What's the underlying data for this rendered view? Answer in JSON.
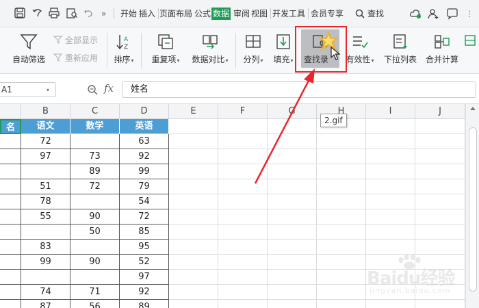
{
  "menubar": {
    "menus": [
      "开始",
      "插入",
      "页面布局",
      "公式",
      "数据",
      "审阅",
      "视图",
      "开发工具",
      "会员专享"
    ],
    "active_menu": "数据",
    "search_label": "查找",
    "more_glyph": "»"
  },
  "ribbon": {
    "autofilter": "自动筛选",
    "show_all": "全部显示",
    "reapply": "重新应用",
    "sort": "排序",
    "duplicates": "重复项",
    "compare": "数据对比",
    "split": "分列",
    "fill": "填充",
    "find_entry": "查找录",
    "validity": "有效性",
    "dropdown_list": "下拉列表",
    "consolidate": "合并计算"
  },
  "formulabar": {
    "namebox": "A1",
    "fx": "fx",
    "content": "姓名"
  },
  "grid": {
    "columns": [
      "B",
      "C",
      "D",
      "E",
      "F",
      "G",
      "H",
      "I",
      "J"
    ],
    "header_row": {
      "a": "名",
      "b": "语文",
      "c": "数学",
      "d": "英语"
    },
    "rows": [
      {
        "b": "72",
        "c": "",
        "d": "63"
      },
      {
        "b": "97",
        "c": "73",
        "d": "92"
      },
      {
        "b": "",
        "c": "89",
        "d": "99"
      },
      {
        "b": "51",
        "c": "72",
        "d": "79"
      },
      {
        "b": "78",
        "c": "",
        "d": "54"
      },
      {
        "b": "55",
        "c": "90",
        "d": "72"
      },
      {
        "b": "",
        "c": "50",
        "d": "85"
      },
      {
        "b": "83",
        "c": "",
        "d": "95"
      },
      {
        "b": "99",
        "c": "90",
        "d": "52"
      },
      {
        "b": "",
        "c": "",
        "d": "97"
      },
      {
        "b": "74",
        "c": "71",
        "d": "92"
      },
      {
        "b": "87",
        "c": "56",
        "d": "89"
      }
    ]
  },
  "tooltip": "2.gif",
  "watermark": {
    "brand": "Baidu经验",
    "url": "jingyan.baidu.com"
  },
  "colors": {
    "accent_green": "#1e9b55",
    "header_blue": "#4e9ed6",
    "highlight_red": "#e8262b"
  }
}
